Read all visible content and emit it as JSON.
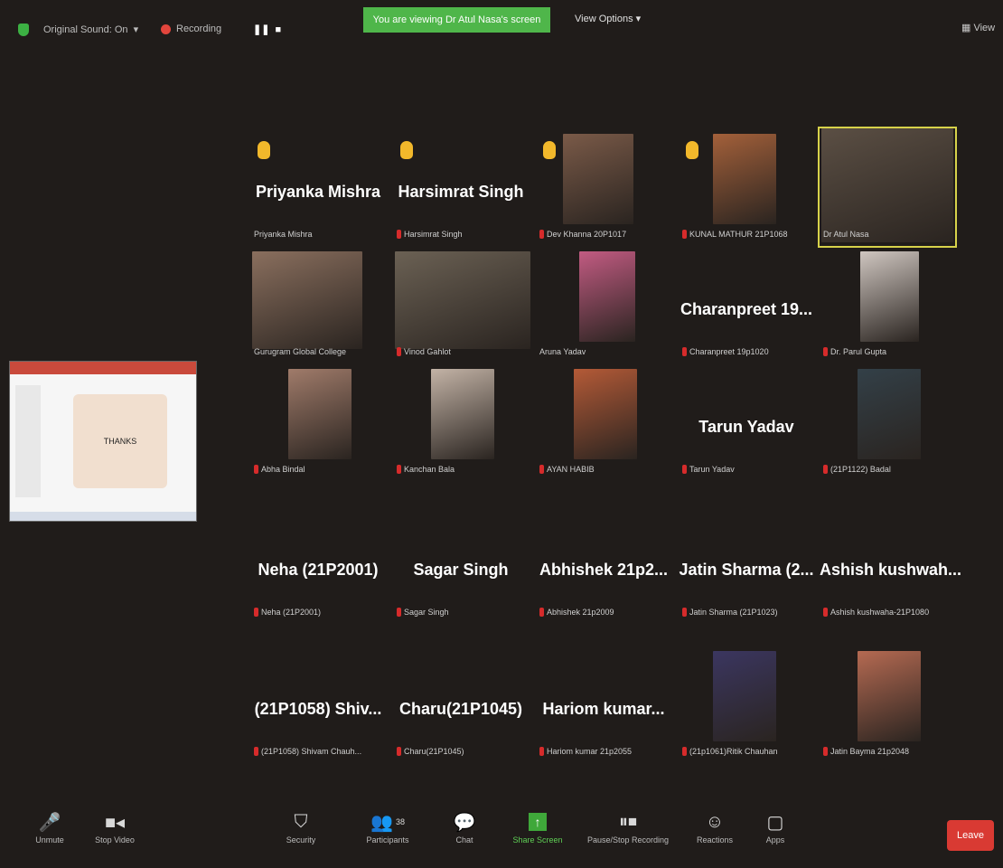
{
  "topbar": {
    "original_sound": "Original Sound: On",
    "recording": "Recording",
    "banner": "You are viewing Dr Atul Nasa's screen",
    "view_options": "View Options",
    "view": "View"
  },
  "share_thumbnail": {
    "slide_text": "THANKS"
  },
  "tiles": [
    {
      "big": "Priyanka Mishra",
      "caption": "Priyanka Mishra",
      "hand": true,
      "muted": false
    },
    {
      "big": "Harsimrat Singh",
      "caption": "Harsimrat Singh",
      "hand": true,
      "muted": true
    },
    {
      "big": "",
      "caption": "Dev Khanna 20P1017",
      "hand": true,
      "muted": true
    },
    {
      "big": "",
      "caption": "KUNAL MATHUR 21P1068",
      "hand": true,
      "muted": true
    },
    {
      "big": "",
      "caption": "Dr Atul Nasa",
      "hand": false,
      "muted": false
    },
    {
      "big": "",
      "caption": "Gurugram Global College",
      "hand": false,
      "muted": false
    },
    {
      "big": "",
      "caption": "Vinod Gahlot",
      "hand": false,
      "muted": true
    },
    {
      "big": "",
      "caption": "Aruna Yadav",
      "hand": false,
      "muted": false
    },
    {
      "big": "Charanpreet 19...",
      "caption": "Charanpreet 19p1020",
      "hand": false,
      "muted": true
    },
    {
      "big": "",
      "caption": "Dr. Parul Gupta",
      "hand": false,
      "muted": true
    },
    {
      "big": "",
      "caption": "Abha Bindal",
      "hand": false,
      "muted": true
    },
    {
      "big": "",
      "caption": "Kanchan Bala",
      "hand": false,
      "muted": true
    },
    {
      "big": "",
      "caption": "AYAN HABIB",
      "hand": false,
      "muted": true
    },
    {
      "big": "Tarun Yadav",
      "caption": "Tarun Yadav",
      "hand": false,
      "muted": true
    },
    {
      "big": "",
      "caption": "(21P1122) Badal",
      "hand": false,
      "muted": true
    },
    {
      "big": "Neha (21P2001)",
      "caption": "Neha (21P2001)",
      "hand": false,
      "muted": true
    },
    {
      "big": "Sagar Singh",
      "caption": "Sagar Singh",
      "hand": false,
      "muted": true
    },
    {
      "big": "Abhishek 21p2...",
      "caption": "Abhishek 21p2009",
      "hand": false,
      "muted": true
    },
    {
      "big": "Jatin Sharma (2...",
      "caption": "Jatin Sharma (21P1023)",
      "hand": false,
      "muted": true
    },
    {
      "big": "Ashish kushwah...",
      "caption": "Ashish kushwaha-21P1080",
      "hand": false,
      "muted": true
    },
    {
      "big": "(21P1058) Shiv...",
      "caption": "(21P1058) Shivam Chauh...",
      "hand": false,
      "muted": true
    },
    {
      "big": "Charu(21P1045)",
      "caption": "Charu(21P1045)",
      "hand": false,
      "muted": true
    },
    {
      "big": "Hariom kumar...",
      "caption": "Hariom kumar 21p2055",
      "hand": false,
      "muted": true
    },
    {
      "big": "",
      "caption": "(21p1061)Ritik Chauhan",
      "hand": false,
      "muted": true
    },
    {
      "big": "",
      "caption": "Jatin Bayma 21p2048",
      "hand": false,
      "muted": true
    }
  ],
  "toolbar": {
    "unmute": "Unmute",
    "stop_video": "Stop Video",
    "security": "Security",
    "participants": "Participants",
    "participants_count": "38",
    "chat": "Chat",
    "share_screen": "Share Screen",
    "pause_recording": "Pause/Stop Recording",
    "reactions": "Reactions",
    "apps": "Apps",
    "leave": "Leave"
  },
  "colors": {
    "background": "#201c1a",
    "banner": "#4fb64a",
    "leave": "#d93a33",
    "muted_mic": "#d62b2b",
    "raised_hand": "#f2b82b",
    "active_speaker": "#d7d24a"
  }
}
